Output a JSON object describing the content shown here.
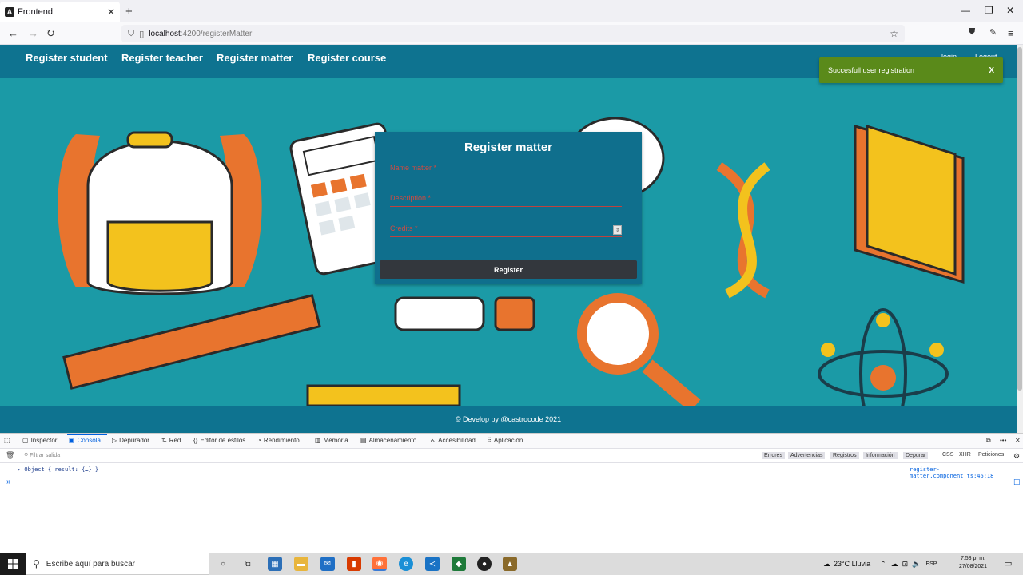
{
  "browser": {
    "tab_title": "Frontend",
    "url_host": "localhost",
    "url_path": ":4200/registerMatter"
  },
  "nav": {
    "links": [
      "Register student",
      "Register teacher",
      "Register matter",
      "Register course"
    ],
    "login": "login",
    "logout": "Logout"
  },
  "snackbar": {
    "message": "Succesfull user registration",
    "close": "X"
  },
  "form": {
    "title": "Register matter",
    "name_label": "Name matter *",
    "description_label": "Description *",
    "credits_label": "Credits *",
    "submit": "Register"
  },
  "footer": {
    "text": "© Develop by @castrocode 2021"
  },
  "devtools": {
    "tabs": [
      "Inspector",
      "Consola",
      "Depurador",
      "Red",
      "Editor de estilos",
      "Rendimiento",
      "Memoria",
      "Almacenamiento",
      "Accesibilidad",
      "Aplicación"
    ],
    "filter_placeholder": "Filtrar salida",
    "levels": [
      "Errores",
      "Advertencias",
      "Registros",
      "Información",
      "Depurar"
    ],
    "right_filters": [
      "CSS",
      "XHR",
      "Peticiones"
    ],
    "log_line": "▸ Object { result: {…} }",
    "log_source": "register-matter.component.ts:46:18"
  },
  "taskbar": {
    "search_placeholder": "Escribe aquí para buscar",
    "weather": "23°C  Lluvia",
    "lang": "ESP",
    "time": "7:58 p. m.",
    "date": "27/08/2021"
  },
  "colors": {
    "header": "#0e7390",
    "background": "#1b9aa6",
    "snackbar": "#5a8a1a"
  }
}
